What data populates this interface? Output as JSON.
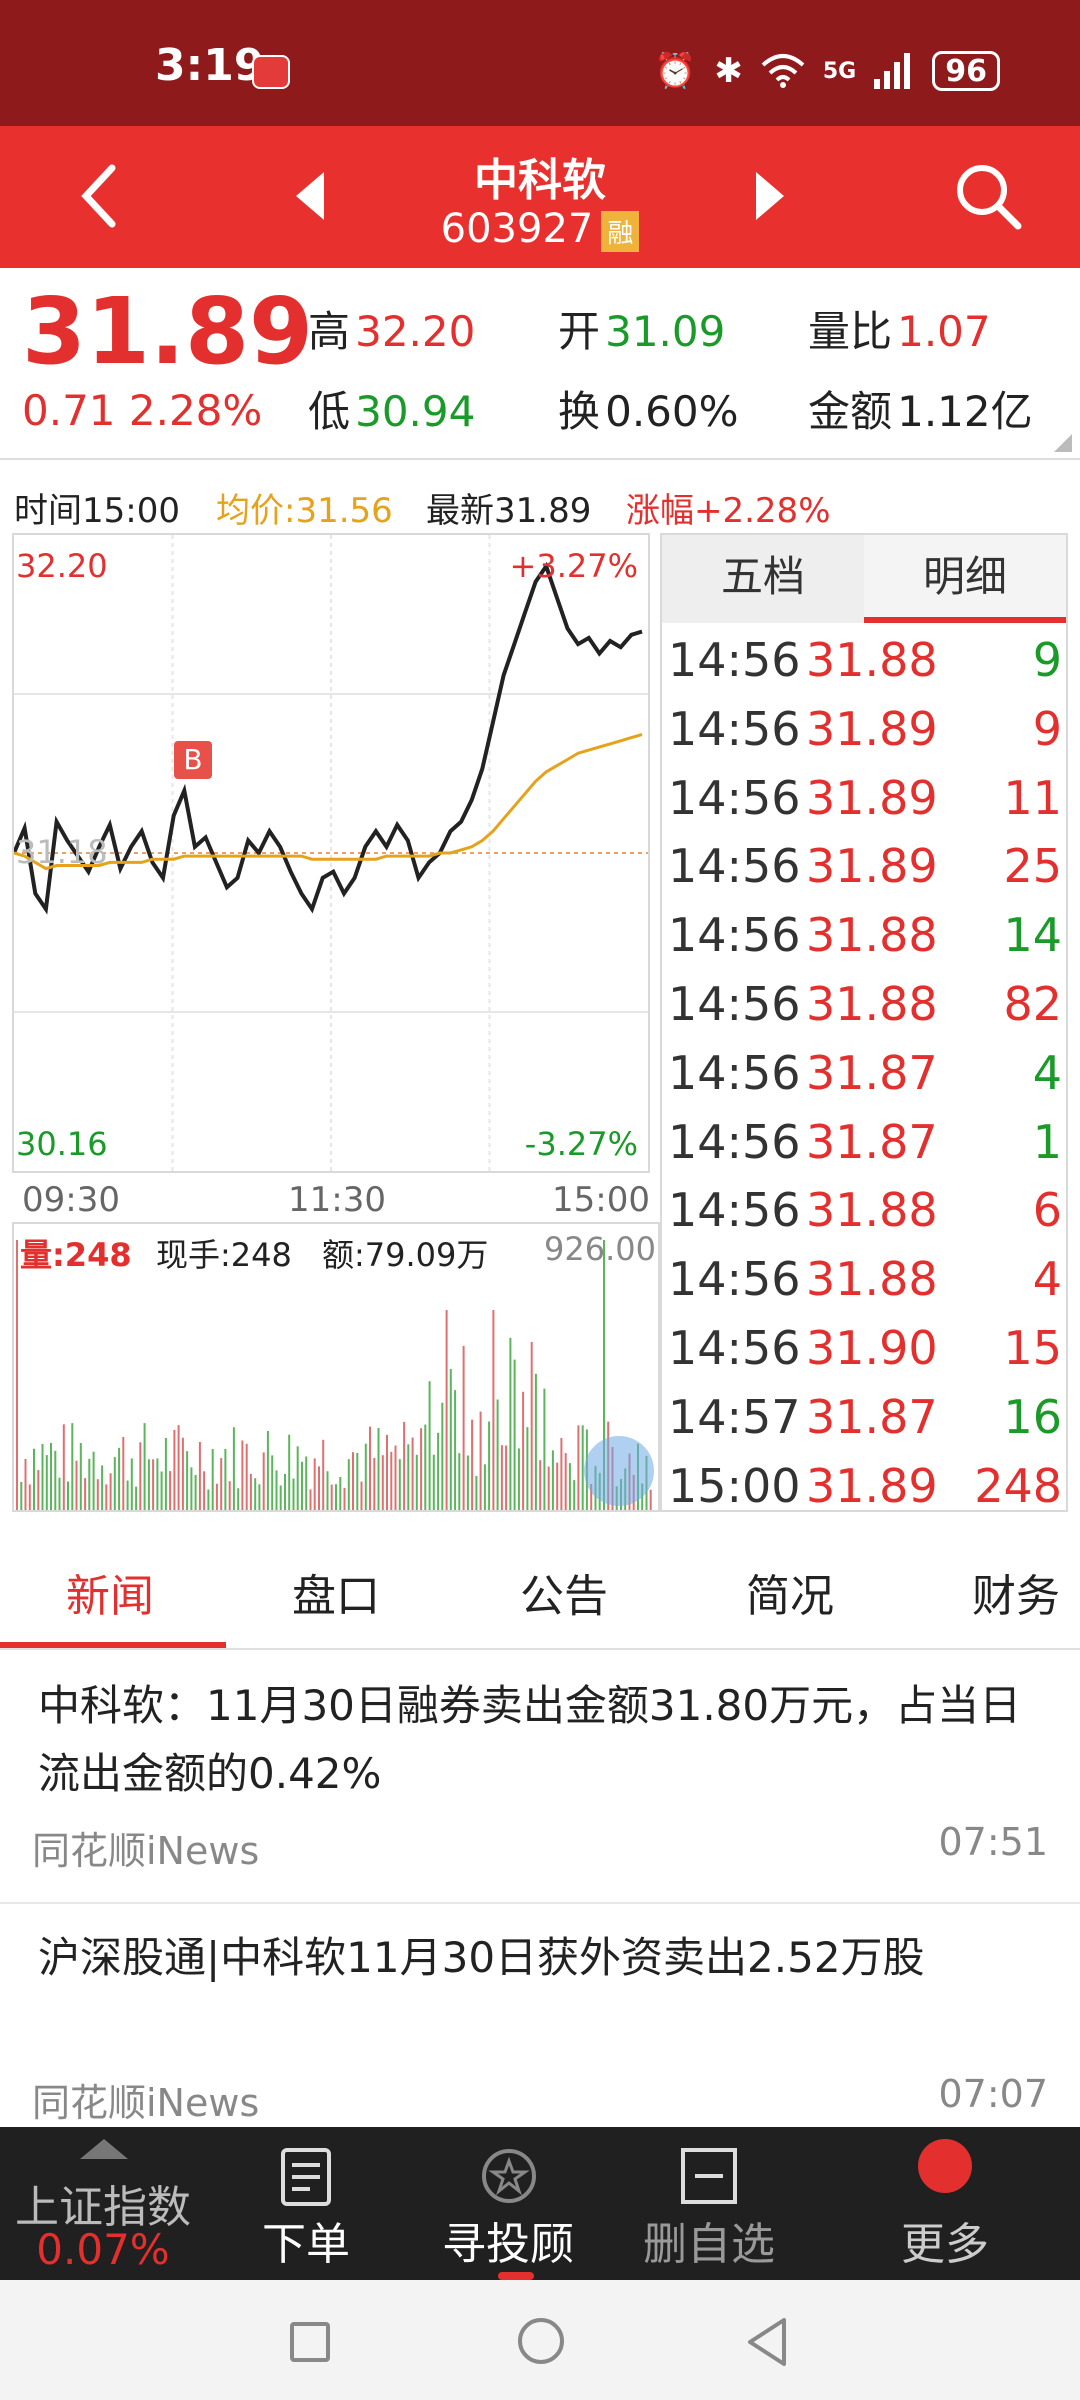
{
  "status": {
    "time": "3:19",
    "battery": "96",
    "network": "5G"
  },
  "header": {
    "name": "中科软",
    "code": "603927",
    "badge": "融"
  },
  "quote": {
    "price": "31.89",
    "change": "0.71",
    "change_pct": "2.28%",
    "high_label": "高",
    "high": "32.20",
    "low_label": "低",
    "low": "30.94",
    "open_label": "开",
    "open": "31.09",
    "turnover_label": "换",
    "turnover": "0.60%",
    "vol_ratio_label": "量比",
    "vol_ratio": "1.07",
    "amount_label": "金额",
    "amount": "1.12亿"
  },
  "info_bar": {
    "time": "时间15:00",
    "avg": "均价:31.56",
    "latest": "最新31.89",
    "pct": "涨幅+2.28%"
  },
  "chart": {
    "top_price": "32.20",
    "bottom_price": "30.16",
    "mid_price": "31.18",
    "top_pct": "+3.27%",
    "bottom_pct": "-3.27%",
    "marker": "B",
    "times": [
      "09:30",
      "11:30",
      "15:00"
    ]
  },
  "chart_data": {
    "type": "line",
    "ylim": [
      30.16,
      32.2
    ],
    "series": [
      {
        "name": "price",
        "values": [
          31.18,
          31.26,
          31.05,
          31.0,
          31.28,
          31.22,
          31.17,
          31.12,
          31.2,
          31.27,
          31.13,
          31.2,
          31.25,
          31.15,
          31.1,
          31.3,
          31.38,
          31.2,
          31.23,
          31.15,
          31.07,
          31.1,
          31.22,
          31.18,
          31.25,
          31.2,
          31.12,
          31.05,
          31.0,
          31.1,
          31.12,
          31.05,
          31.1,
          31.2,
          31.25,
          31.2,
          31.27,
          31.22,
          31.1,
          31.15,
          31.18,
          31.25,
          31.28,
          31.35,
          31.45,
          31.6,
          31.75,
          31.85,
          31.95,
          32.05,
          32.1,
          32.0,
          31.9,
          31.85,
          31.87,
          31.82,
          31.86,
          31.84,
          31.88,
          31.89
        ]
      },
      {
        "name": "avg",
        "values": [
          31.18,
          31.17,
          31.15,
          31.13,
          31.14,
          31.14,
          31.14,
          31.14,
          31.14,
          31.15,
          31.15,
          31.15,
          31.15,
          31.16,
          31.16,
          31.16,
          31.17,
          31.17,
          31.17,
          31.17,
          31.17,
          31.17,
          31.17,
          31.17,
          31.17,
          31.17,
          31.17,
          31.17,
          31.16,
          31.16,
          31.16,
          31.16,
          31.16,
          31.16,
          31.16,
          31.17,
          31.17,
          31.17,
          31.17,
          31.17,
          31.18,
          31.18,
          31.19,
          31.2,
          31.22,
          31.25,
          31.29,
          31.33,
          31.37,
          31.41,
          31.44,
          31.46,
          31.48,
          31.5,
          31.51,
          31.52,
          31.53,
          31.54,
          31.55,
          31.56
        ]
      }
    ]
  },
  "volume": {
    "vol": "量:248",
    "now": "现手:248",
    "amt": "额:79.09万",
    "max": "926.00"
  },
  "detail": {
    "tabs": [
      "五档",
      "明细"
    ],
    "rows": [
      {
        "t": "14:56",
        "p": "31.88",
        "v": "9",
        "c": "green"
      },
      {
        "t": "14:56",
        "p": "31.89",
        "v": "9",
        "c": "red"
      },
      {
        "t": "14:56",
        "p": "31.89",
        "v": "11",
        "c": "red"
      },
      {
        "t": "14:56",
        "p": "31.89",
        "v": "25",
        "c": "red"
      },
      {
        "t": "14:56",
        "p": "31.88",
        "v": "14",
        "c": "green"
      },
      {
        "t": "14:56",
        "p": "31.88",
        "v": "82",
        "c": "red"
      },
      {
        "t": "14:56",
        "p": "31.87",
        "v": "4",
        "c": "green"
      },
      {
        "t": "14:56",
        "p": "31.87",
        "v": "1",
        "c": "green"
      },
      {
        "t": "14:56",
        "p": "31.88",
        "v": "6",
        "c": "red"
      },
      {
        "t": "14:56",
        "p": "31.88",
        "v": "4",
        "c": "red"
      },
      {
        "t": "14:56",
        "p": "31.90",
        "v": "15",
        "c": "red"
      },
      {
        "t": "14:57",
        "p": "31.87",
        "v": "16",
        "c": "green"
      },
      {
        "t": "15:00",
        "p": "31.89",
        "v": "248",
        "c": "red"
      }
    ]
  },
  "news_tabs": [
    "新闻",
    "盘口",
    "公告",
    "简况",
    "财务"
  ],
  "news": [
    {
      "title": "中科软：11月30日融券卖出金额31.80万元，占当日流出金额的0.42%",
      "source": "同花顺iNews",
      "time": "07:51"
    },
    {
      "title": "沪深股通|中科软11月30日获外资卖出2.52万股",
      "source": "同花顺iNews",
      "time": "07:07"
    }
  ],
  "bottom": {
    "index_label": "上证指数",
    "index_pct": "0.07%",
    "order": "下单",
    "advisor": "寻投顾",
    "remove": "删自选",
    "more": "更多"
  }
}
